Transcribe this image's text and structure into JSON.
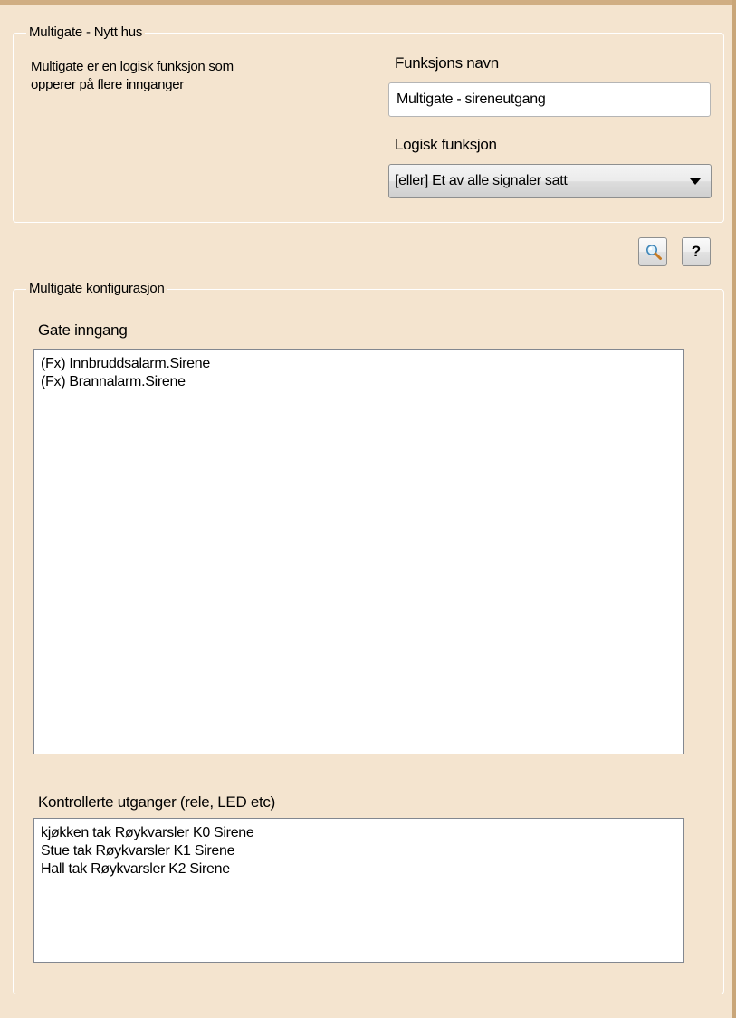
{
  "header_group": {
    "legend": "Multigate - Nytt hus",
    "description_line1": "Multigate er en logisk funksjon som",
    "description_line2": "opperer på flere innganger",
    "function_name_label": "Funksjons navn",
    "function_name_value": "Multigate - sireneutgang",
    "logic_function_label": "Logisk funksjon",
    "logic_function_selected": "[eller]  Et av alle signaler satt"
  },
  "toolbar": {
    "search_icon": "magnifier-icon",
    "help_label": "?"
  },
  "config_group": {
    "legend": "Multigate konfigurasjon",
    "gate_input_label": "Gate inngang",
    "gate_inputs": [
      "(Fx) Innbruddsalarm.Sirene",
      "(Fx) Brannalarm.Sirene"
    ],
    "outputs_label": "Kontrollerte utganger (rele, LED etc)",
    "outputs": [
      "kjøkken tak Røykvarsler K0 Sirene",
      "Stue tak Røykvarsler K1 Sirene",
      "Hall tak Røykvarsler K2 Sirene"
    ]
  },
  "colors": {
    "panel_background": "#f4e4cf",
    "top_border": "#d0ae83"
  }
}
